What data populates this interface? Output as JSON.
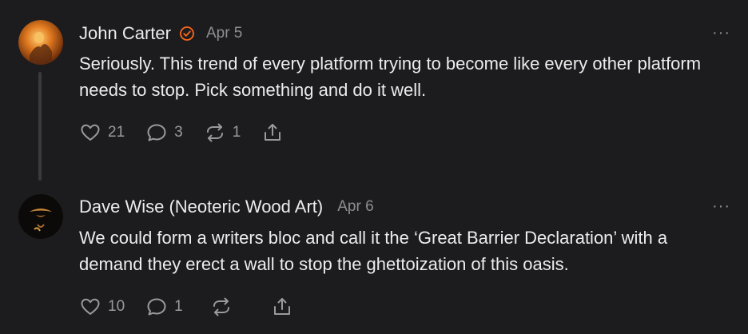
{
  "posts": [
    {
      "author": "John Carter",
      "verified": true,
      "date": "Apr 5",
      "more": "···",
      "text": "Seriously. This trend of every platform trying to become like every other platform needs to stop. Pick something and do it well.",
      "likes": "21",
      "comments": "3",
      "restacks": "1",
      "avatar": "orange-artwork-avatar"
    },
    {
      "author": "Dave Wise (Neoteric Wood Art)",
      "verified": false,
      "date": "Apr 6",
      "more": "···",
      "text": "We could form a writers bloc and call it the ‘Great Barrier Declaration’ with a demand they erect a wall to stop the ghettoization of this oasis.",
      "likes": "10",
      "comments": "1",
      "restacks": "",
      "avatar": "dark-woodart-avatar"
    }
  ],
  "colors": {
    "verified": "#ff6719",
    "background": "#1c1c1e",
    "muted": "#8e8e93"
  }
}
